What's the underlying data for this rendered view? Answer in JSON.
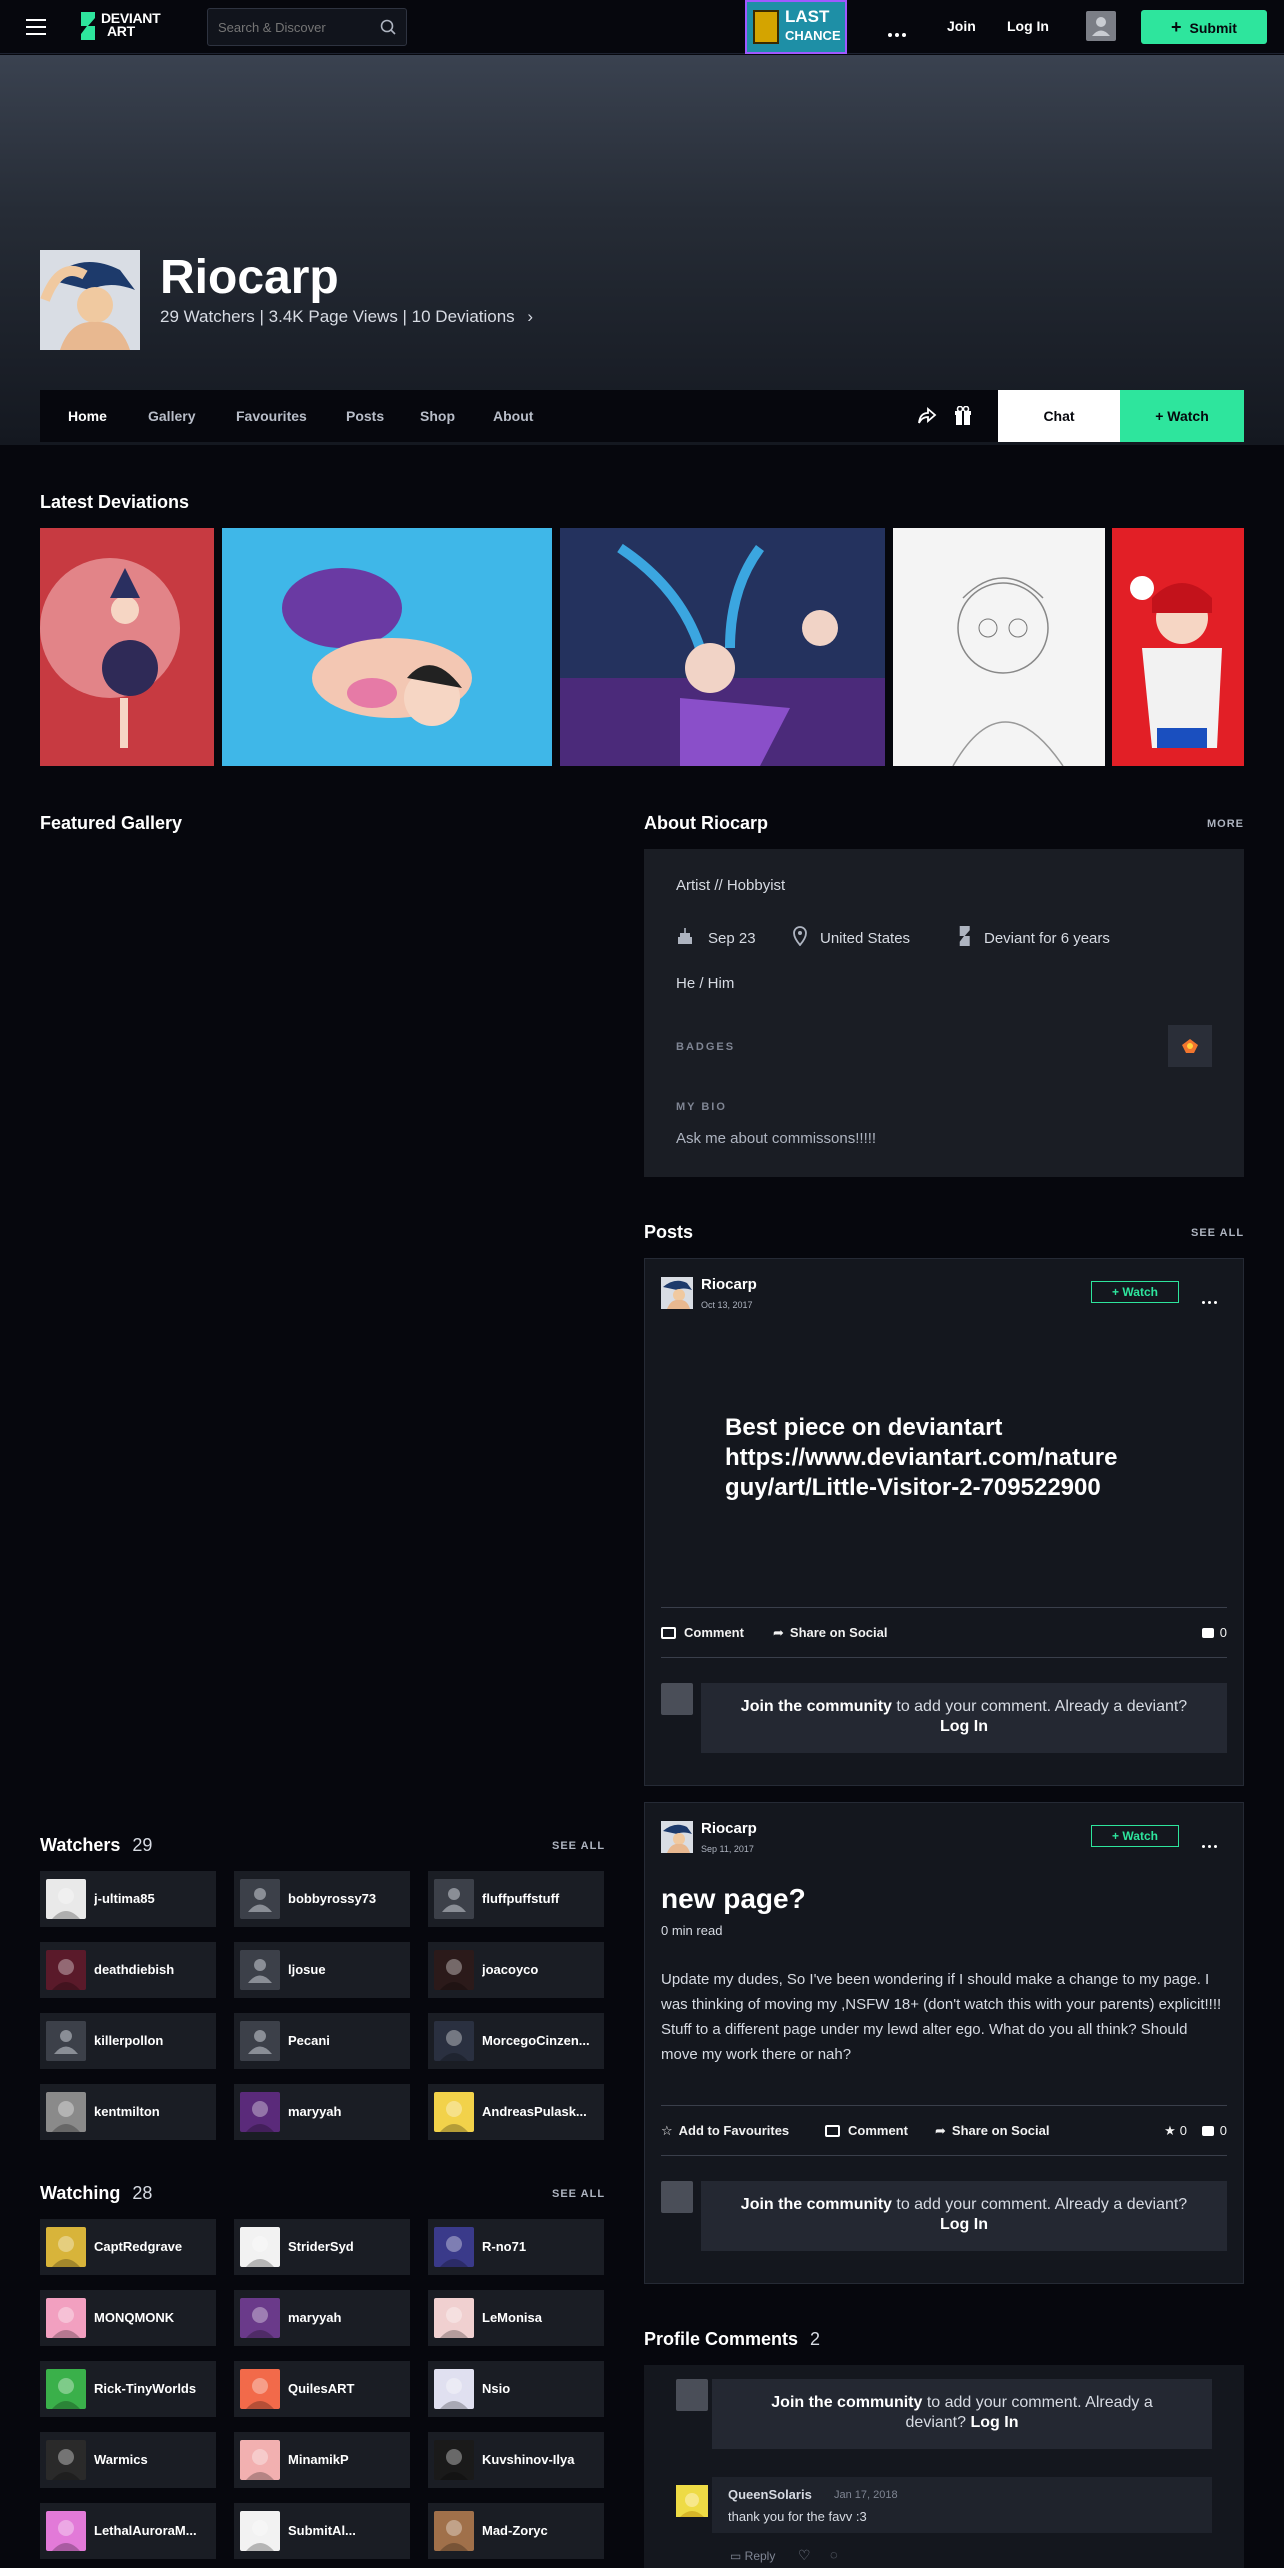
{
  "topbar": {
    "search_placeholder": "Search & Discover",
    "logo_line1": "DEVIANT",
    "logo_line2": "ART",
    "promo_line1": "LAST",
    "promo_line2": "CHANCE",
    "join": "Join",
    "login": "Log In",
    "submit": "Submit"
  },
  "profile": {
    "name": "Riocarp",
    "stats": "29 Watchers  |  3.4K Page Views  |  10 Deviations"
  },
  "nav": {
    "tabs": [
      "Home",
      "Gallery",
      "Favourites",
      "Posts",
      "Shop",
      "About"
    ],
    "chat": "Chat",
    "watch": "+ Watch"
  },
  "latest": {
    "title": "Latest Deviations"
  },
  "featured": {
    "title": "Featured Gallery"
  },
  "about": {
    "title": "About Riocarp",
    "more": "MORE",
    "role": "Artist  //  Hobbyist",
    "birthday": "Sep 23",
    "location": "United States",
    "member": "Deviant for 6 years",
    "pronouns": "He / Him",
    "badges_label": "BADGES",
    "bio_label": "MY BIO",
    "bio": "Ask me about commissons!!!!!"
  },
  "posts": {
    "title": "Posts",
    "see_all": "SEE ALL",
    "items": [
      {
        "author": "Riocarp",
        "date": "Oct 13, 2017",
        "watch": "+ Watch",
        "body_line1": "Best piece on deviantart",
        "body_line2": "https://www.deviantart.com/nature",
        "body_line3": "guy/art/Little-Visitor-2-709522900",
        "comment": "Comment",
        "share": "Share on Social",
        "comment_count": "0"
      },
      {
        "author": "Riocarp",
        "date": "Sep 11, 2017",
        "watch": "+ Watch",
        "title": "new page?",
        "read": "0 min read",
        "body": "Update my dudes, So I've been wondering if I should make a change to my page. I was thinking of moving my ,NSFW 18+ (don't watch this with your parents) explicit!!!! Stuff to a different page under my lewd alter ego. What do you all think? Should move my work there or nah?",
        "fav": "Add to Favourites",
        "comment": "Comment",
        "share": "Share on Social",
        "fav_count": "0",
        "comment_count": "0"
      }
    ],
    "join_bold": "Join the community",
    "join_rest": " to add your comment. Already a deviant?",
    "login": "Log In"
  },
  "watchers": {
    "title": "Watchers",
    "count": "29",
    "see_all": "SEE ALL",
    "users": [
      "j-ultima85",
      "bobbyrossy73",
      "fluffpuffstuff",
      "deathdiebish",
      "ljosue",
      "joacoyco",
      "killerpollon",
      "Pecani",
      "MorcegoCinzen...",
      "kentmilton",
      "maryyah",
      "AndreasPulask..."
    ]
  },
  "watching": {
    "title": "Watching",
    "count": "28",
    "see_all": "SEE ALL",
    "users": [
      "CaptRedgrave",
      "StriderSyd",
      "R-no71",
      "MONQMONK",
      "maryyah",
      "LeMonisa",
      "Rick-TinyWorlds",
      "QuilesART",
      "Nsio",
      "Warmics",
      "MinamikP",
      "Kuvshinov-Ilya",
      "LethalAuroraM...",
      "SubmitAl...",
      "Mad-Zoryc"
    ]
  },
  "profile_comments": {
    "title": "Profile Comments",
    "count": "2",
    "join_bold": "Join the community",
    "join_rest": " to add your comment. Already a deviant?",
    "login": "Log In",
    "comment_author": "QueenSolaris",
    "comment_date": "Jan 17, 2018",
    "comment_text": "thank you for the favv :3",
    "reply": "Reply"
  },
  "colors": {
    "accent": "#2ee59d",
    "background": "#06070d",
    "card": "#1a1d24"
  }
}
